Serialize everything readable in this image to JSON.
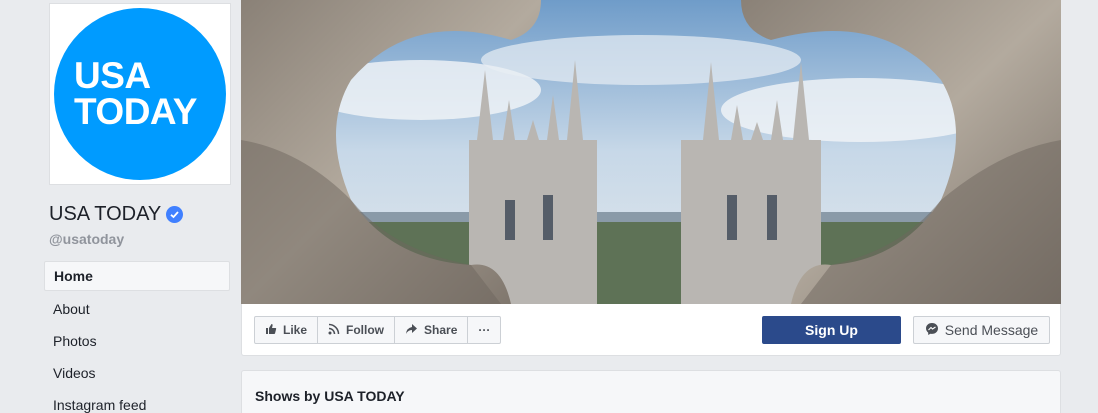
{
  "profile": {
    "logo_line1": "USA",
    "logo_line2": "TODAY",
    "name": "USA TODAY",
    "handle": "@usatoday",
    "brand_color": "#009bff"
  },
  "nav": {
    "items": [
      {
        "label": "Home",
        "active": true
      },
      {
        "label": "About"
      },
      {
        "label": "Photos"
      },
      {
        "label": "Videos"
      },
      {
        "label": "Instagram feed"
      }
    ]
  },
  "actions": {
    "like": "Like",
    "follow": "Follow",
    "share": "Share",
    "more": "···",
    "signup": "Sign Up",
    "message": "Send Message",
    "signup_color": "#2b4a8b"
  },
  "shows": {
    "title": "Shows by USA TODAY"
  }
}
